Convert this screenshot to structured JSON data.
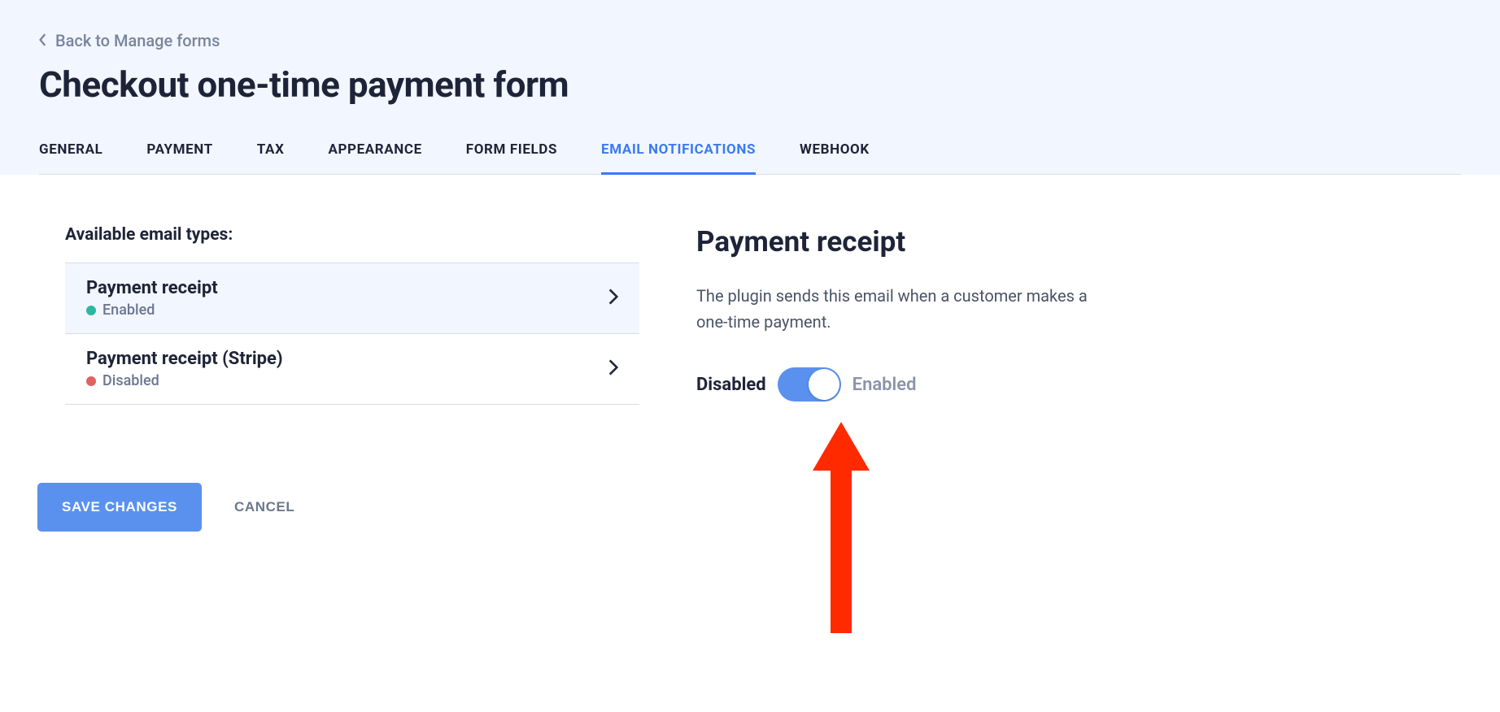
{
  "header": {
    "back_label": "Back to Manage forms",
    "title": "Checkout one-time payment form"
  },
  "tabs": [
    {
      "label": "GENERAL",
      "active": false
    },
    {
      "label": "PAYMENT",
      "active": false
    },
    {
      "label": "TAX",
      "active": false
    },
    {
      "label": "APPEARANCE",
      "active": false
    },
    {
      "label": "FORM FIELDS",
      "active": false
    },
    {
      "label": "EMAIL NOTIFICATIONS",
      "active": true
    },
    {
      "label": "WEBHOOK",
      "active": false
    }
  ],
  "email_types": {
    "section_label": "Available email types:",
    "items": [
      {
        "title": "Payment receipt",
        "status_label": "Enabled",
        "status": "enabled",
        "selected": true
      },
      {
        "title": "Payment receipt (Stripe)",
        "status_label": "Disabled",
        "status": "disabled",
        "selected": false
      }
    ]
  },
  "actions": {
    "save_label": "SAVE CHANGES",
    "cancel_label": "CANCEL"
  },
  "detail": {
    "title": "Payment receipt",
    "description": "The plugin sends this email when a customer makes a one-time payment.",
    "disabled_label": "Disabled",
    "enabled_label": "Enabled",
    "toggle_on": true
  }
}
